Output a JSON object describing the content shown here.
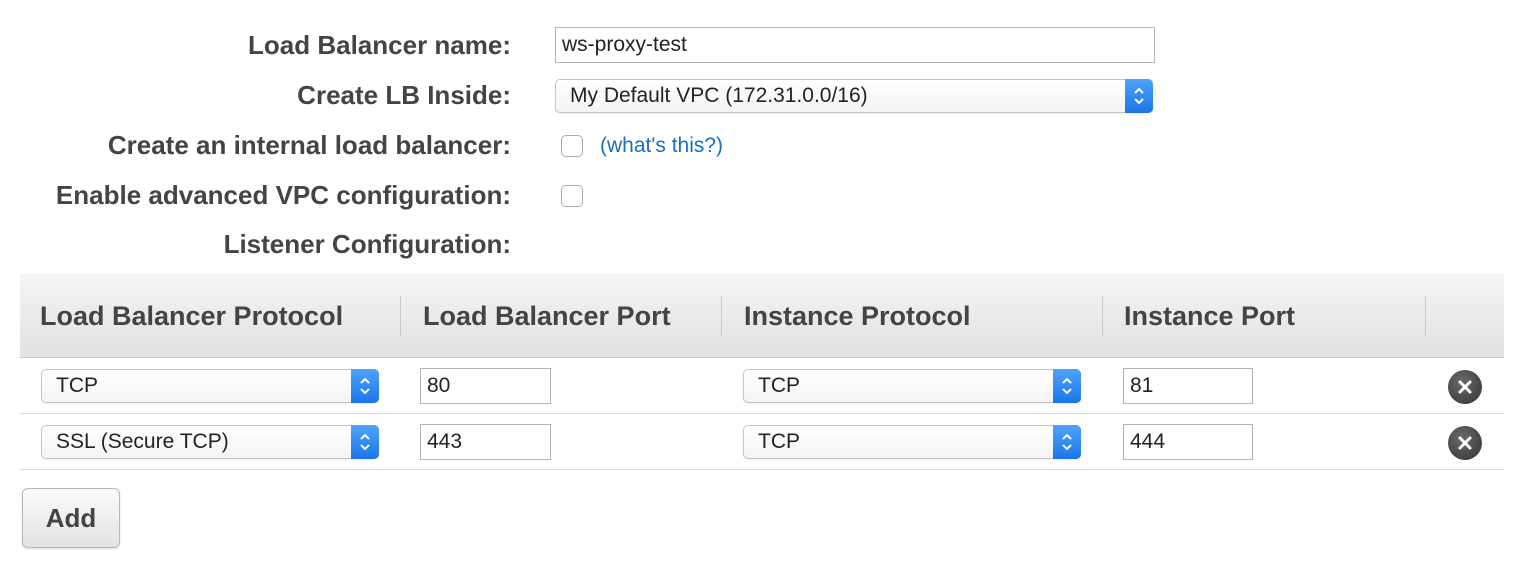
{
  "form": {
    "lb_name_label": "Load Balancer name:",
    "lb_name_value": "ws-proxy-test",
    "create_inside_label": "Create LB Inside:",
    "create_inside_value": "My Default VPC (172.31.0.0/16)",
    "internal_lb_label": "Create an internal load balancer:",
    "internal_lb_checked": false,
    "whats_this_link": "(what's this?)",
    "advanced_vpc_label": "Enable advanced VPC configuration:",
    "advanced_vpc_checked": false,
    "listener_config_label": "Listener Configuration:"
  },
  "listeners": {
    "headers": [
      "Load Balancer Protocol",
      "Load Balancer Port",
      "Instance Protocol",
      "Instance Port"
    ],
    "rows": [
      {
        "lb_protocol": "TCP",
        "lb_port": "80",
        "instance_protocol": "TCP",
        "instance_port": "81"
      },
      {
        "lb_protocol": "SSL (Secure TCP)",
        "lb_port": "443",
        "instance_protocol": "TCP",
        "instance_port": "444"
      }
    ],
    "add_label": "Add"
  },
  "icons": {
    "select_arrow": "updown-chevron-icon",
    "remove": "close-circle-icon"
  },
  "colors": {
    "accent": "#1a76e8",
    "link": "#1a6fbf",
    "header_bg": "#e2e2e2"
  }
}
